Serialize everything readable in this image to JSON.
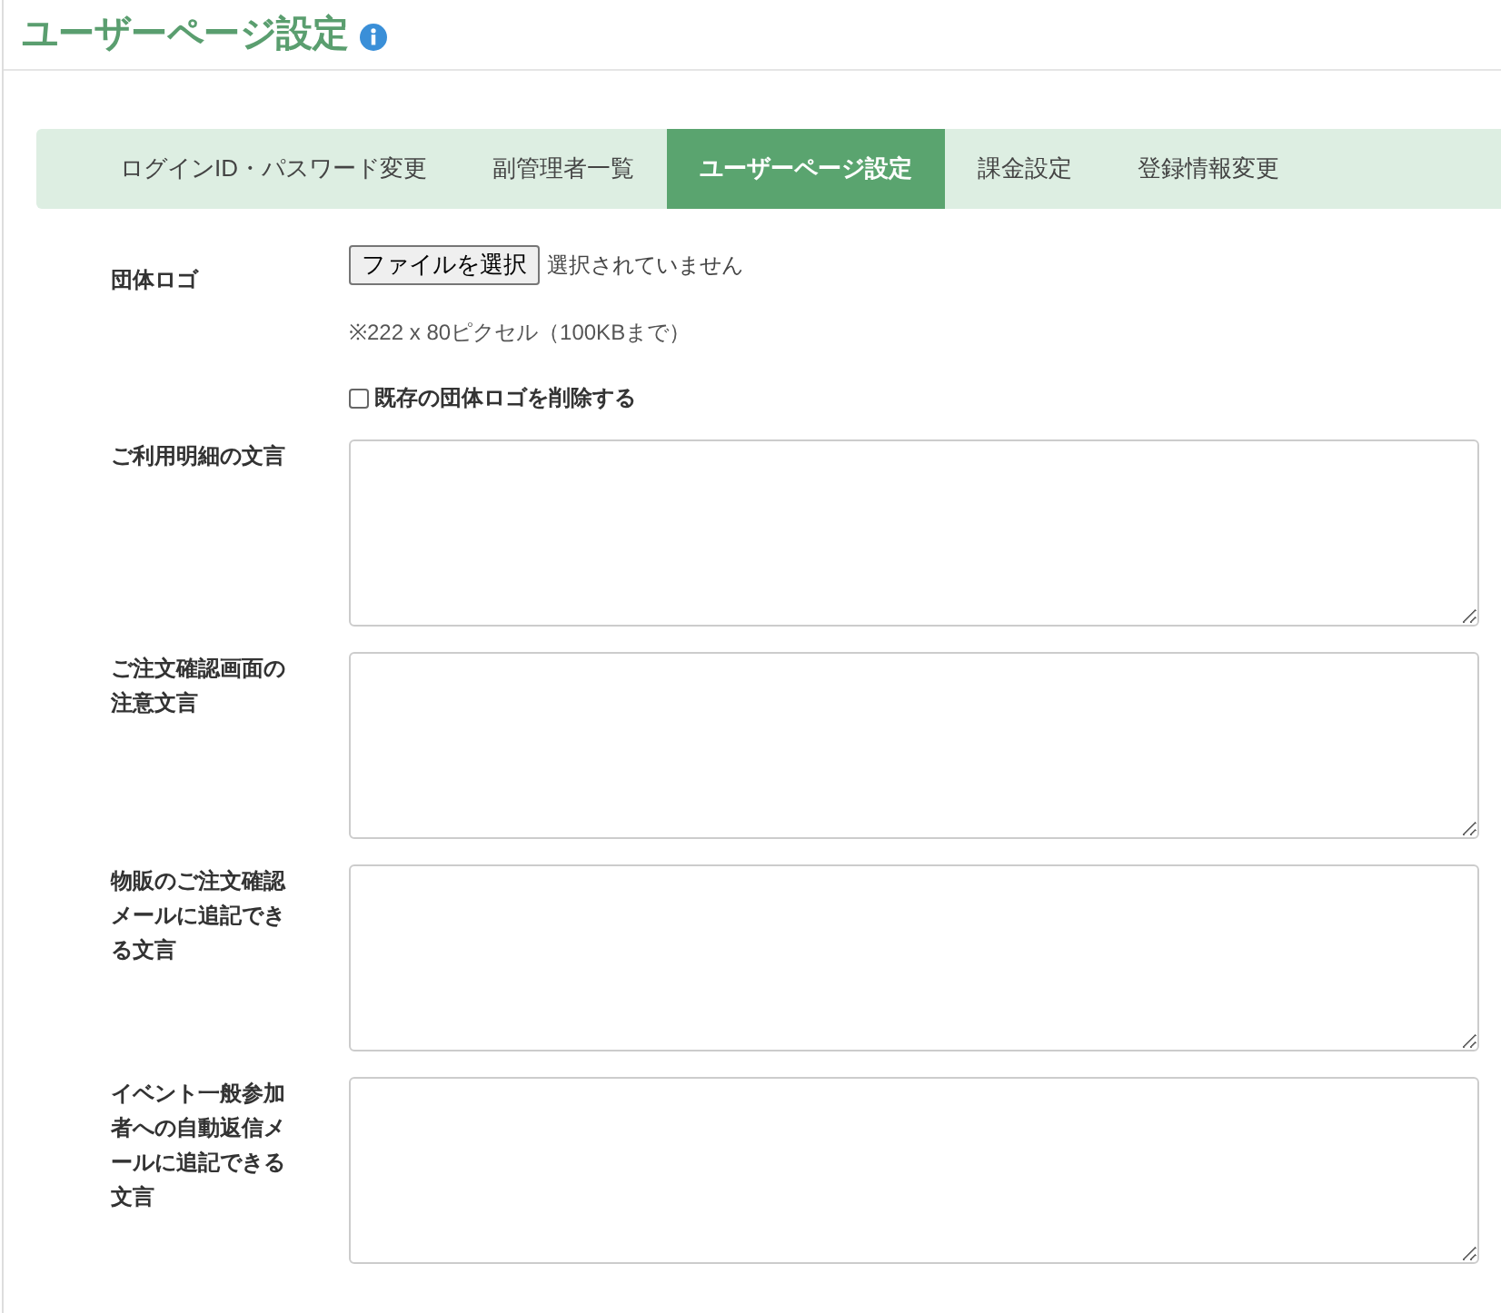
{
  "page_title": "ユーザーページ設定",
  "tabs": [
    {
      "label": "ログインID・パスワード変更",
      "selected": false
    },
    {
      "label": "副管理者一覧",
      "selected": false
    },
    {
      "label": "ユーザーページ設定",
      "selected": true
    },
    {
      "label": "課金設定",
      "selected": false
    },
    {
      "label": "登録情報変更",
      "selected": false
    }
  ],
  "form": [
    {
      "kind": "file",
      "label": "団体ロゴ",
      "button": "ファイルを選択",
      "file_status": "選択されていません",
      "hint": "※222 x 80ピクセル（100KBまで）",
      "checkbox": {
        "label": "既存の団体ロゴを削除する",
        "checked": false
      }
    },
    {
      "kind": "textarea",
      "label": "ご利用明細の文言"
    },
    {
      "kind": "textarea",
      "label": "ご注文確認画面の注意文言"
    },
    {
      "kind": "textarea",
      "label": "物販のご注文確認メールに追記できる文言"
    },
    {
      "kind": "textarea",
      "label": "イベント一般参加者への自動返信メールに追記できる文言"
    }
  ]
}
